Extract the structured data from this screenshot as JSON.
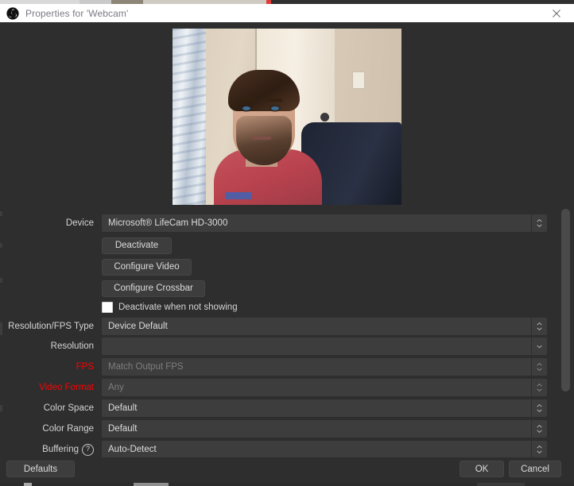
{
  "window": {
    "title": "Properties for 'Webcam'",
    "app_icon": "obs-logo-icon",
    "close_icon": "close-icon"
  },
  "preview": {
    "name": "webcam-preview",
    "description": "Live webcam preview of a bearded person in a red t-shirt seated in a room with a door, light wall, wall switch and a curtain on the left"
  },
  "form": {
    "device": {
      "label": "Device",
      "value": "Microsoft® LifeCam HD-3000"
    },
    "buttons": {
      "deactivate": "Deactivate",
      "configure_video": "Configure Video",
      "configure_crossbar": "Configure Crossbar"
    },
    "deactivate_when_not_showing": {
      "label": "Deactivate when not showing",
      "checked": false
    },
    "res_fps_type": {
      "label": "Resolution/FPS Type",
      "value": "Device Default"
    },
    "resolution": {
      "label": "Resolution",
      "value": ""
    },
    "fps": {
      "label": "FPS",
      "value": "Match Output FPS",
      "label_color": "#ff0000",
      "disabled": true
    },
    "video_format": {
      "label": "Video Format",
      "value": "Any",
      "label_color": "#ff0000",
      "disabled": true
    },
    "color_space": {
      "label": "Color Space",
      "value": "Default"
    },
    "color_range": {
      "label": "Color Range",
      "value": "Default"
    },
    "buffering": {
      "label": "Buffering",
      "help_icon": "question-mark-icon",
      "value": "Auto-Detect"
    }
  },
  "footer": {
    "defaults": "Defaults",
    "ok": "OK",
    "cancel": "Cancel"
  },
  "theme": {
    "window_bg": "#2e2e2e",
    "field_bg": "#3d3d3d",
    "text": "#d4d4d4",
    "titlebar_bg": "#ffffff",
    "titlebar_text": "#7a7a86",
    "error_red": "#ff0000"
  }
}
